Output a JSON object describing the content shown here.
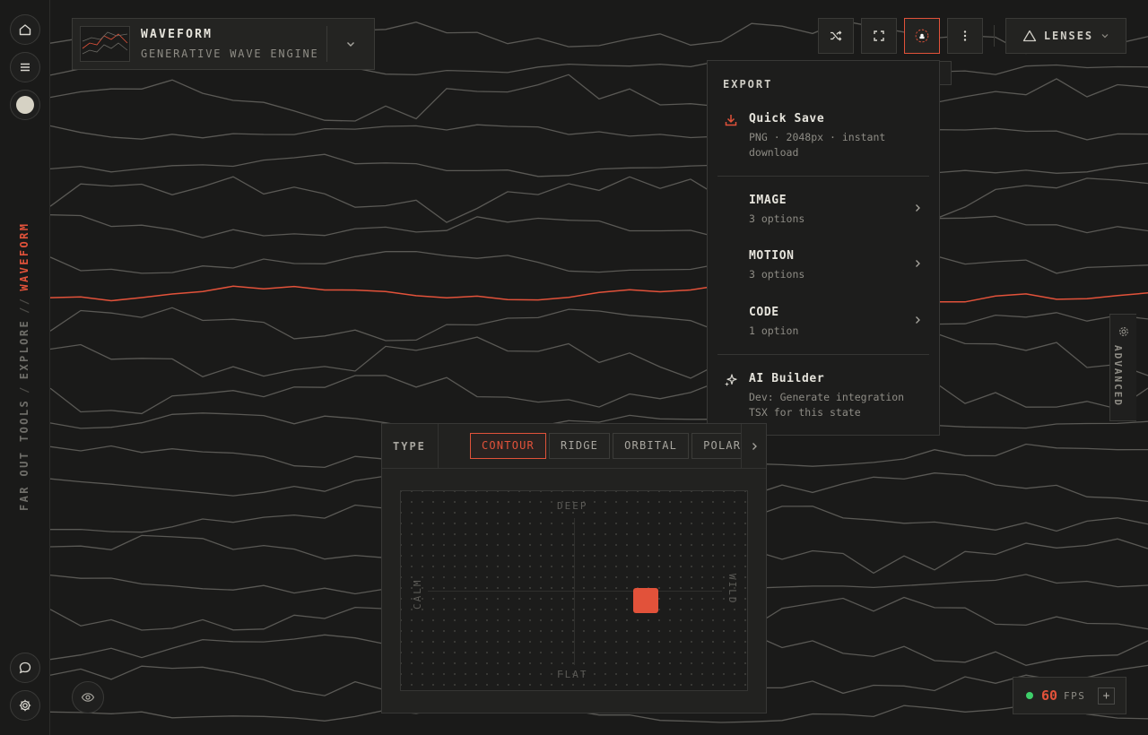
{
  "app": {
    "accent": "#e2523a",
    "background": "#1a1a19"
  },
  "breadcrumb": {
    "root": "FAR OUT TOOLS",
    "section": "EXPLORE",
    "current": "WAVEFORM",
    "sep1": "/",
    "sep2": "//"
  },
  "title_card": {
    "title": "WAVEFORM",
    "subtitle": "GENERATIVE WAVE ENGINE"
  },
  "toolbar": {
    "icons": [
      "shuffle-icon",
      "fullscreen-icon",
      "export-icon",
      "more-icon"
    ],
    "lenses_label": "LENSES"
  },
  "export_menu": {
    "heading": "EXPORT",
    "quick_save": {
      "title": "Quick Save",
      "desc": "PNG · 2048px · instant download"
    },
    "groups": [
      {
        "title": "IMAGE",
        "desc": "3 options"
      },
      {
        "title": "MOTION",
        "desc": "3 options"
      },
      {
        "title": "CODE",
        "desc": "1 option"
      }
    ],
    "ai_builder": {
      "title": "AI Builder",
      "desc": "Dev: Generate integration TSX for this state"
    }
  },
  "advanced_tab": {
    "label": "ADVANCED"
  },
  "type_panel": {
    "label": "TYPE",
    "options": [
      "CONTOUR",
      "RIDGE",
      "ORBITAL",
      "POLAR"
    ],
    "selected": "CONTOUR",
    "pad": {
      "top": "DEEP",
      "bottom": "FLAT",
      "left": "CALM",
      "right": "WILD",
      "value_x": 0.72,
      "value_y": 0.55
    }
  },
  "fps": {
    "value": "60",
    "unit": "FPS",
    "plus": "+"
  }
}
